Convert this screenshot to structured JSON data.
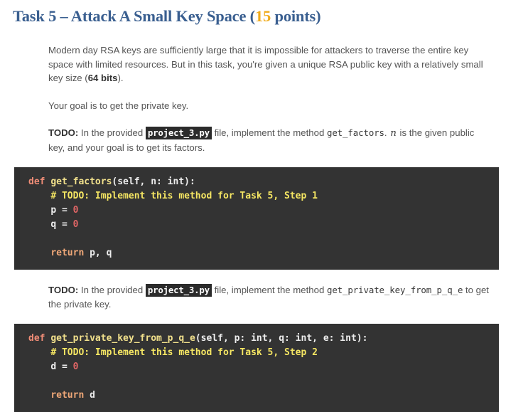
{
  "title": {
    "prefix": "Task 5 – Attack A Small Key Space (",
    "points_value": "15",
    "suffix": " points)"
  },
  "paragraphs": {
    "intro_part1": "Modern day RSA keys are sufficiently large that it is impossible for attackers to traverse the entire key space with limited resources. But in this task, you're given a unique RSA public key with a relatively small key size (",
    "intro_bold": "64 bits",
    "intro_part2": ").",
    "goal": "Your goal is to get the private key.",
    "todo_label": "TODO:",
    "todo1_part1": " In the provided ",
    "todo1_file": "project_3.py",
    "todo1_part2": " file, implement the method ",
    "todo1_method": "get_factors",
    "todo1_part3": ". ",
    "todo1_var": "n",
    "todo1_part4": " is the given public key, and your goal is to get its factors.",
    "todo2_part1": " In the provided ",
    "todo2_file": "project_3.py",
    "todo2_part2": " file, implement the method ",
    "todo2_method": "get_private_key_from_p_q_e",
    "todo2_part3": " to get the private key."
  },
  "code_block_1": {
    "def_keyword": "def",
    "fn_name": "get_factors",
    "signature": "(self, n: int):",
    "comment": "# TODO: Implement this method for Task 5, Step 1",
    "line_p_name": "p = ",
    "line_p_value": "0",
    "line_q_name": "q = ",
    "line_q_value": "0",
    "return_keyword": "return",
    "return_value": " p, q"
  },
  "code_block_2": {
    "def_keyword": "def",
    "fn_name": "get_private_key_from_p_q_e",
    "signature": "(self, p: int, q: int, e: int):",
    "comment": "# TODO: Implement this method for Task 5, Step 2",
    "line_d_name": "d = ",
    "line_d_value": "0",
    "return_keyword": "return",
    "return_value": " d"
  },
  "colors": {
    "title_blue": "#3a5f90",
    "points_gold": "#f0ac1d",
    "code_bg": "#333333",
    "comment_yellow": "#f5e663",
    "keyword_red": "#f08d77",
    "number_red": "#e06666",
    "fn_yellow": "#f2e18c",
    "return_orange": "#f0a878"
  }
}
